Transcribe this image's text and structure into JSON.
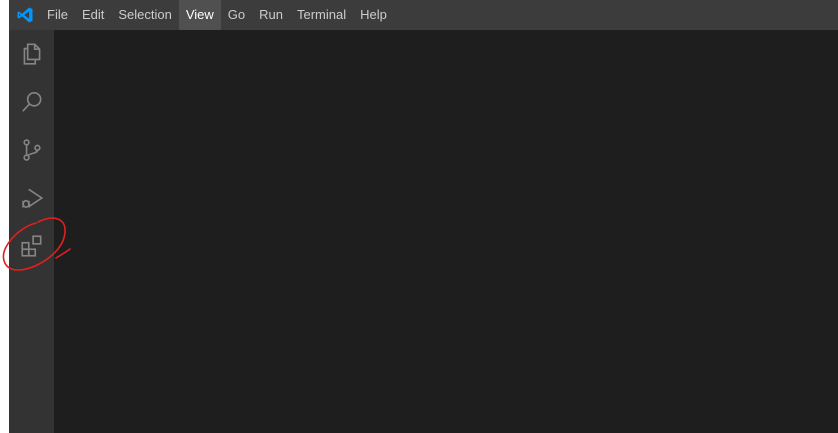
{
  "app": {
    "logo_icon": "vscode-logo-icon",
    "accent": "#0098ff"
  },
  "menu": {
    "items": [
      {
        "label": "File"
      },
      {
        "label": "Edit"
      },
      {
        "label": "Selection"
      },
      {
        "label": "View",
        "active": true
      },
      {
        "label": "Go"
      },
      {
        "label": "Run"
      },
      {
        "label": "Terminal"
      },
      {
        "label": "Help"
      }
    ]
  },
  "activity_bar": {
    "items": [
      {
        "icon": "explorer-icon"
      },
      {
        "icon": "search-icon"
      },
      {
        "icon": "source-control-icon"
      },
      {
        "icon": "run-debug-icon"
      },
      {
        "icon": "extensions-icon",
        "annotated": true
      }
    ]
  },
  "annotation": {
    "color": "#e02020",
    "shape": "circle-around-extensions-icon"
  },
  "colors": {
    "titlebar": "#3c3c3c",
    "activitybar": "#333333",
    "editor": "#1e1e1e",
    "icon": "#858585"
  }
}
